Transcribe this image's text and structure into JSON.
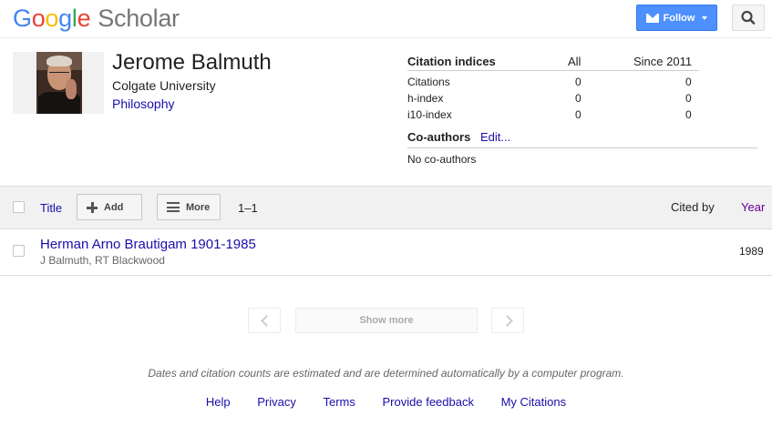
{
  "header": {
    "logo_google": "Google",
    "logo_scholar": "Scholar",
    "follow_label": "Follow"
  },
  "profile": {
    "name": "Jerome Balmuth",
    "affiliation": "Colgate University",
    "field": "Philosophy"
  },
  "citations": {
    "title": "Citation indices",
    "col_all": "All",
    "col_since": "Since 2011",
    "rows": [
      {
        "label": "Citations",
        "all": "0",
        "since": "0"
      },
      {
        "label": "h-index",
        "all": "0",
        "since": "0"
      },
      {
        "label": "i10-index",
        "all": "0",
        "since": "0"
      }
    ]
  },
  "coauthors": {
    "title": "Co-authors",
    "edit": "Edit...",
    "empty": "No co-authors"
  },
  "toolbar": {
    "title": "Title",
    "add": "Add",
    "more": "More",
    "range": "1–1",
    "cited_by": "Cited by",
    "year": "Year"
  },
  "publications": [
    {
      "title": "Herman Arno Brautigam 1901-1985",
      "authors": "J Balmuth, RT Blackwood",
      "year": "1989"
    }
  ],
  "pagination": {
    "show_more": "Show more"
  },
  "note": "Dates and citation counts are estimated and are determined automatically by a computer program.",
  "footer": [
    "Help",
    "Privacy",
    "Terms",
    "Provide feedback",
    "My Citations"
  ],
  "colors": {
    "link": "#1a0dab",
    "visited": "#660099",
    "follow_bg": "#4d90fe"
  }
}
